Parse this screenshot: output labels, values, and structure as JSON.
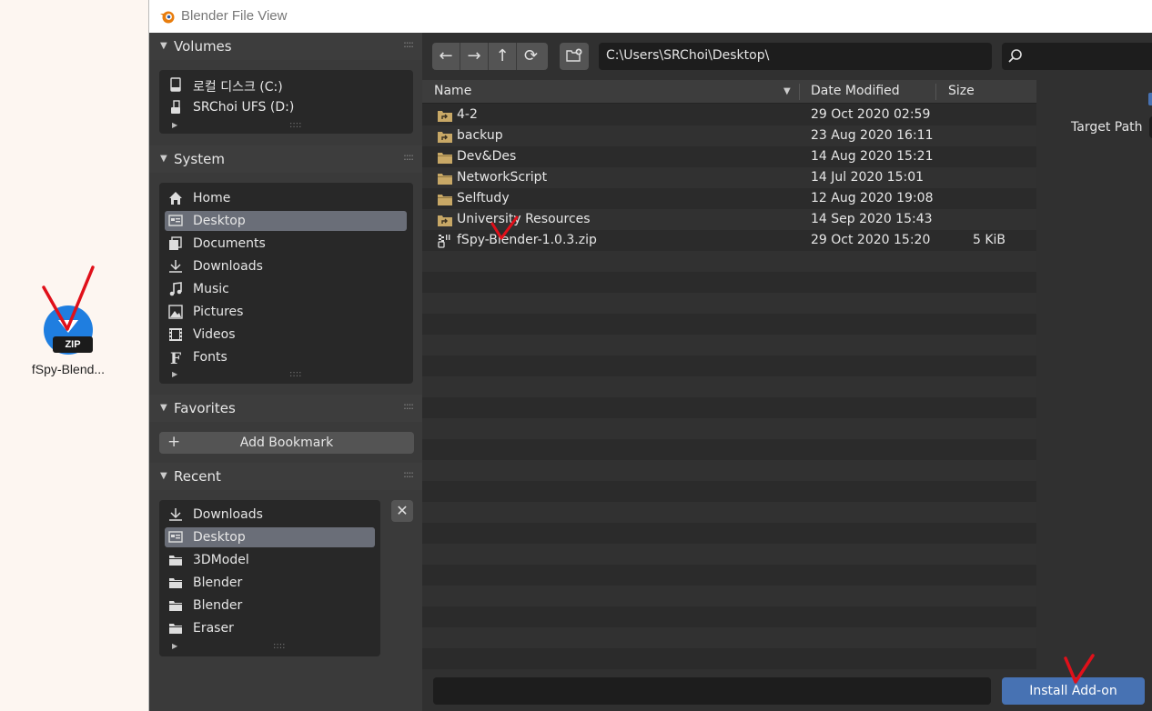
{
  "desktop": {
    "zip_icon": {
      "icon": "zip-archive-icon",
      "badge": "ZIP",
      "label": "fSpy-Blend..."
    }
  },
  "window": {
    "title": "Blender File View",
    "icon": "blender-logo-icon"
  },
  "sidebar": {
    "volumes": {
      "title": "Volumes",
      "items": [
        {
          "label": "로컬 디스크 (C:)",
          "icon": "disk-drive-icon",
          "selected": false
        },
        {
          "label": "SRChoi UFS (D:)",
          "icon": "removable-drive-icon",
          "selected": false
        }
      ]
    },
    "system": {
      "title": "System",
      "items": [
        {
          "label": "Home",
          "icon": "home-icon",
          "selected": false
        },
        {
          "label": "Desktop",
          "icon": "desktop-icon",
          "selected": true
        },
        {
          "label": "Documents",
          "icon": "documents-icon",
          "selected": false
        },
        {
          "label": "Downloads",
          "icon": "download-icon",
          "selected": false
        },
        {
          "label": "Music",
          "icon": "music-icon",
          "selected": false
        },
        {
          "label": "Pictures",
          "icon": "pictures-icon",
          "selected": false
        },
        {
          "label": "Videos",
          "icon": "videos-icon",
          "selected": false
        },
        {
          "label": "Fonts",
          "icon": "font-icon",
          "selected": false
        }
      ]
    },
    "favorites": {
      "title": "Favorites",
      "add_bookmark_label": "Add Bookmark"
    },
    "recent": {
      "title": "Recent",
      "items": [
        {
          "label": "Downloads",
          "icon": "download-icon",
          "selected": false
        },
        {
          "label": "Desktop",
          "icon": "desktop-icon",
          "selected": true
        },
        {
          "label": "3DModel",
          "icon": "folder-icon",
          "selected": false
        },
        {
          "label": "Blender",
          "icon": "folder-icon",
          "selected": false
        },
        {
          "label": "Blender",
          "icon": "folder-icon",
          "selected": false
        },
        {
          "label": "Eraser",
          "icon": "folder-icon",
          "selected": false
        }
      ]
    }
  },
  "toolbar": {
    "nav_buttons": [
      "arrow-left-icon",
      "arrow-right-icon",
      "parent-directory-icon",
      "refresh-icon"
    ],
    "new_folder_icon": "new-folder-icon",
    "path": "C:\\Users\\SRChoi\\Desktop\\",
    "search_placeholder": "",
    "search_icon": "search-icon"
  },
  "file_list": {
    "columns": {
      "name": "Name",
      "date": "Date Modified",
      "size": "Size"
    },
    "rows": [
      {
        "name": "4-2",
        "date": "29 Oct 2020 02:59",
        "size": "",
        "icon": "folder-link-icon"
      },
      {
        "name": "backup",
        "date": "23 Aug 2020 16:11",
        "size": "",
        "icon": "folder-link-icon"
      },
      {
        "name": "Dev&Des",
        "date": "14 Aug 2020 15:21",
        "size": "",
        "icon": "folder-icon"
      },
      {
        "name": "NetworkScript",
        "date": "14 Jul 2020 15:01",
        "size": "",
        "icon": "folder-icon"
      },
      {
        "name": "Selftudy",
        "date": "12 Aug 2020 19:08",
        "size": "",
        "icon": "folder-icon"
      },
      {
        "name": "University Resources",
        "date": "14 Sep 2020 15:43",
        "size": "",
        "icon": "folder-link-icon"
      },
      {
        "name": "fSpy-Blender-1.0.3.zip",
        "date": "29 Oct 2020 15:20",
        "size": "5 KiB",
        "icon": "zip-file-icon"
      }
    ]
  },
  "options": {
    "target_path_label": "Target Path"
  },
  "bottom": {
    "filename_value": "",
    "install_label": "Install Add-on"
  },
  "colors": {
    "accent": "#4772b3",
    "panel": "#3a3a3a",
    "list_bg": "#2b2b2b",
    "annotation": "#e0101a",
    "folder": "#c8a866"
  }
}
